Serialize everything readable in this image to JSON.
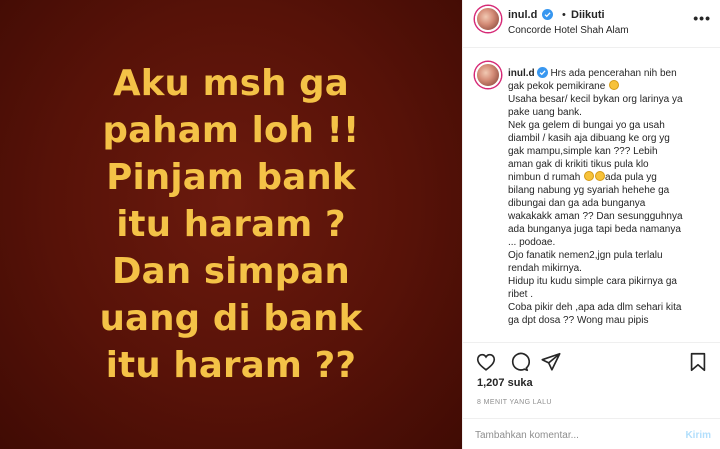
{
  "image": {
    "background_color": "#571208",
    "text_color": "#f4c247",
    "lines": [
      "Aku msh ga",
      "paham loh !!",
      "Pinjam bank",
      "itu haram ?",
      "Dan simpan",
      "uang di bank",
      "itu haram ??"
    ]
  },
  "header": {
    "username": "inul.d",
    "separator": "•",
    "follow_status": "Diikuti",
    "location": "Concorde Hotel Shah Alam",
    "more_icon": "more-horizontal-icon"
  },
  "caption": {
    "username": "inul.d",
    "lines": [
      "Hrs ada pencerahan nih ben",
      "gak pekok pemikirane",
      "Usaha besar/ kecil bykan org larinya ya",
      "pake uang bank.",
      "Nek ga gelem di bungai yo ga usah",
      "diambil / kasih aja dibuang ke org yg",
      "gak mampu,simple kan ??? Lebih",
      "aman gak di krikiti tikus pula klo",
      "nimbun d rumah",
      "ada pula yg",
      "bilang nabung yg syariah hehehe ga",
      "dibungai dan ga ada bunganya",
      "wakakakk aman ?? Dan sesungguhnya",
      "ada bunganya juga tapi beda namanya",
      "... podoae.",
      "Ojo fanatik nemen2,jgn pula terlalu",
      "rendah mikirnya.",
      "Hidup itu kudu simple cara pikirnya ga",
      "ribet .",
      "Coba pikir deh ,apa ada dlm sehari kita",
      "ga dpt dosa ?? Wong mau pipis"
    ]
  },
  "actions": {
    "like_icon": "heart-icon",
    "comment_icon": "comment-icon",
    "share_icon": "send-icon",
    "bookmark_icon": "bookmark-icon"
  },
  "likes": "1,207 suka",
  "time": "8 MENIT YANG LALU",
  "comment_box": {
    "placeholder": "Tambahkan komentar...",
    "post_label": "Kirim"
  },
  "colors": {
    "verified_blue": "#3897f0",
    "post_button_disabled": "#b2dffc"
  }
}
